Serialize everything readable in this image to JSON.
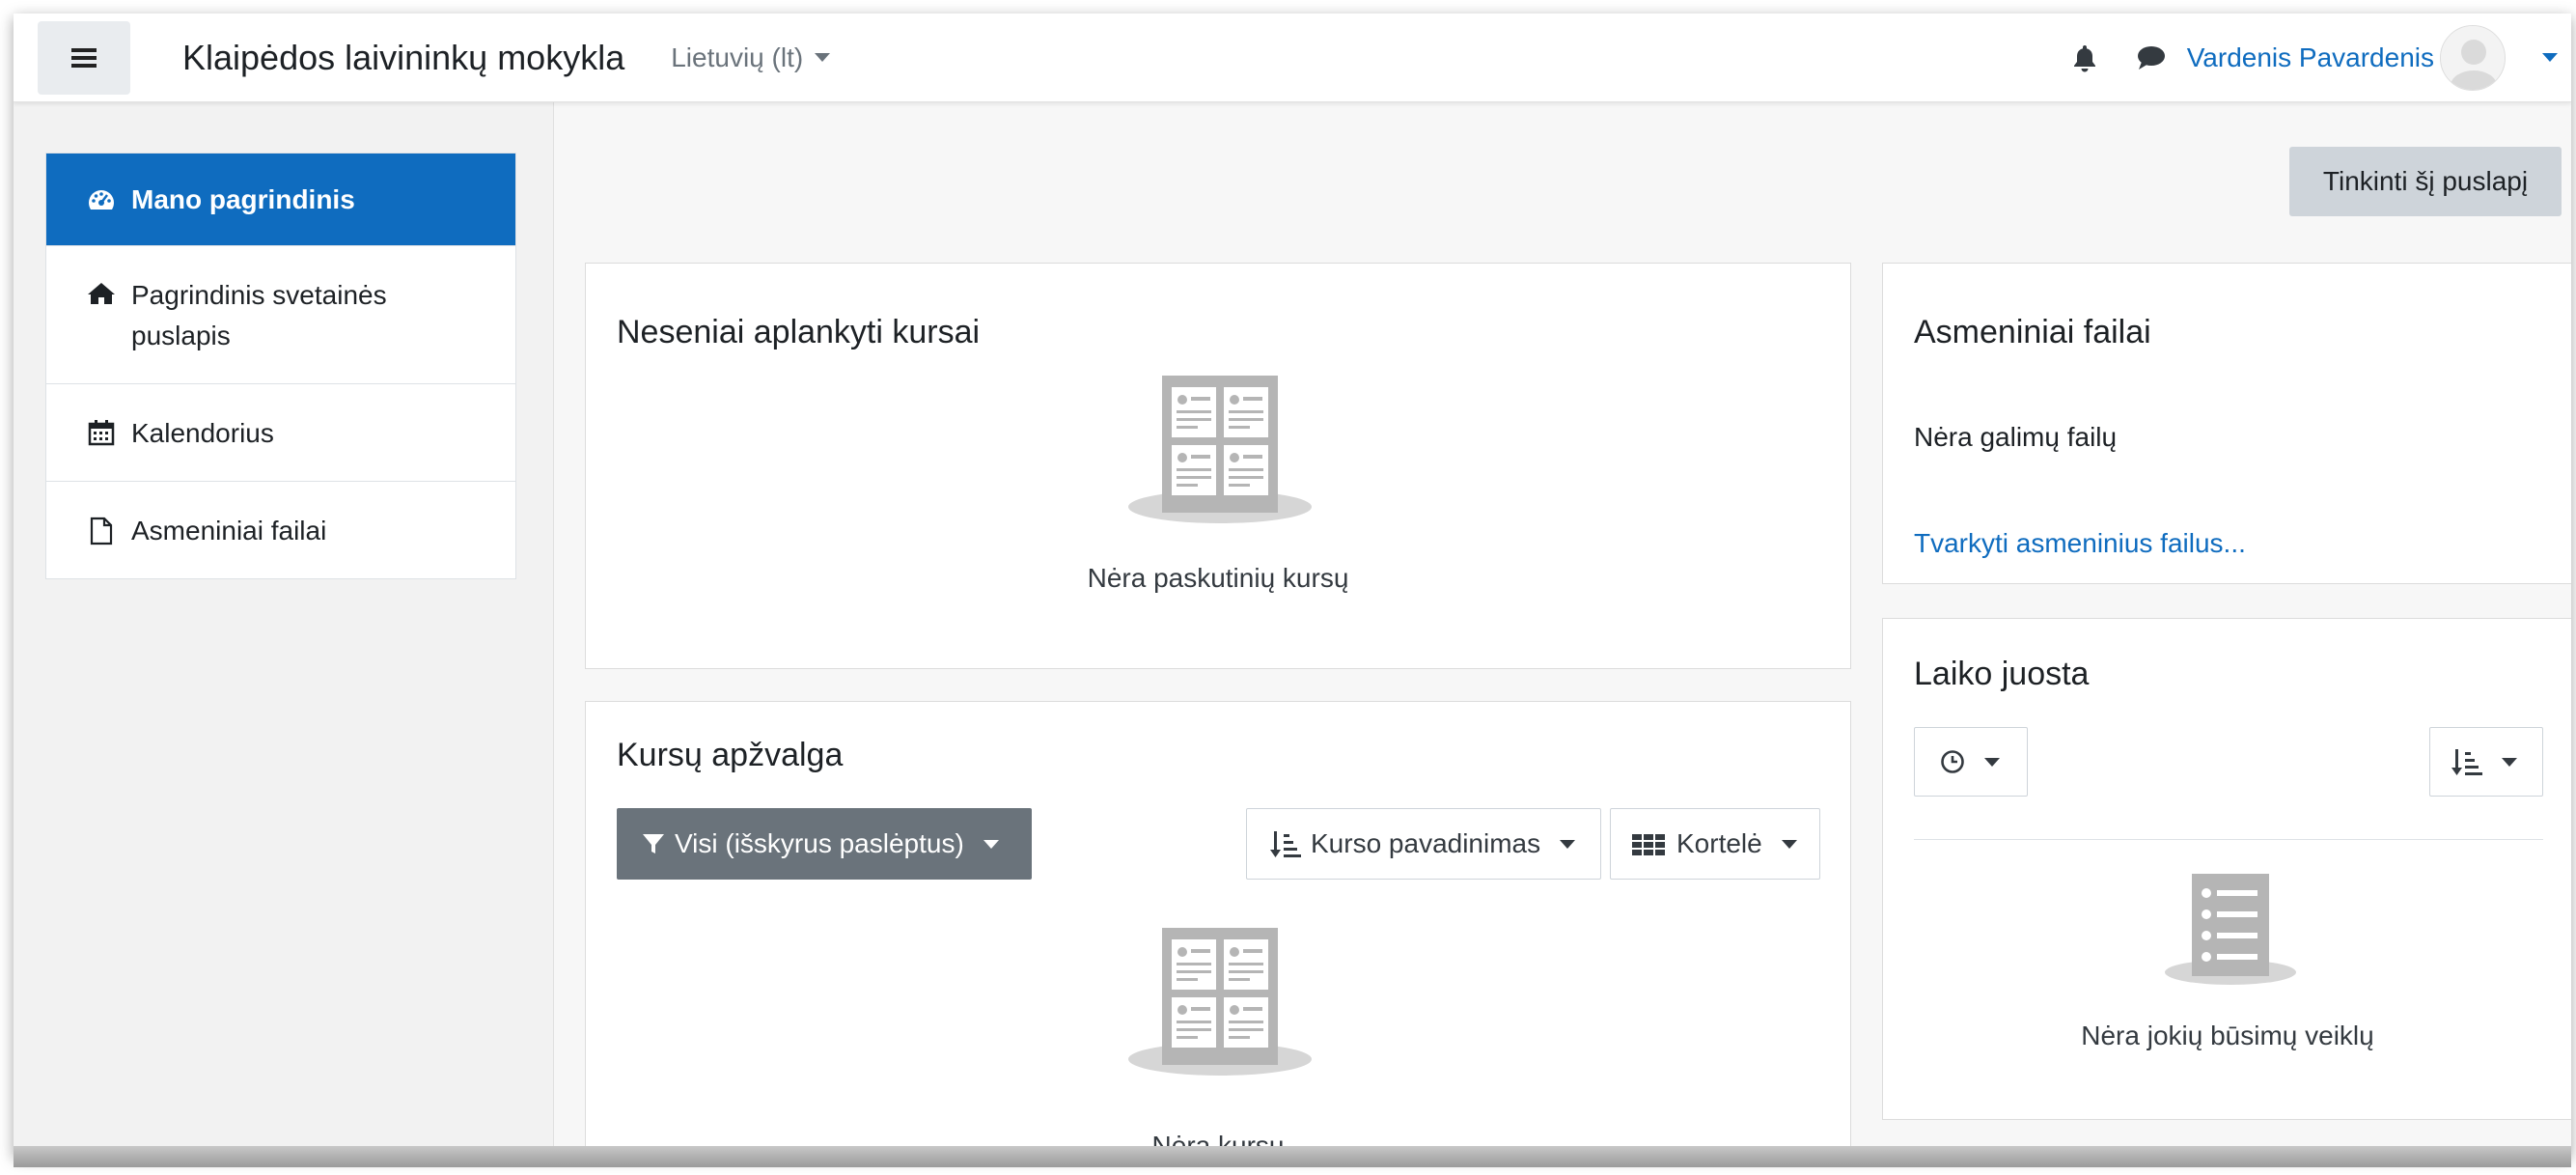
{
  "navbar": {
    "site_name": "Klaipėdos laivininkų mokykla",
    "language": "Lietuvių (lt)",
    "user_name": "Vardenis Pavardenis"
  },
  "drawer": {
    "items": [
      {
        "label": "Mano pagrindinis",
        "icon": "dashboard-icon",
        "active": true
      },
      {
        "label": "Pagrindinis svetainės puslapis",
        "icon": "home-icon",
        "active": false
      },
      {
        "label": "Kalendorius",
        "icon": "calendar-icon",
        "active": false
      },
      {
        "label": "Asmeniniai failai",
        "icon": "file-icon",
        "active": false
      }
    ]
  },
  "page": {
    "customize_label": "Tinkinti šį puslapį"
  },
  "recent_courses": {
    "title": "Neseniai aplankyti kursai",
    "empty_text": "Nėra paskutinių kursų"
  },
  "course_overview": {
    "title": "Kursų apžvalga",
    "filter_label": "Visi (išskyrus paslėptus)",
    "sort_label": "Kurso pavadinimas",
    "view_label": "Kortelė",
    "empty_text": "Nėra kursų"
  },
  "private_files": {
    "title": "Asmeniniai failai",
    "empty_text": "Nėra galimų failų",
    "manage_link": "Tvarkyti asmeninius failus..."
  },
  "timeline": {
    "title": "Laiko juosta",
    "empty_text": "Nėra jokių būsimų veiklų"
  },
  "colors": {
    "primary": "#0f6cbf",
    "secondary_btn": "#ced4da",
    "filter_btn": "#6a737b",
    "empty_illustration": "#b5b5b5"
  }
}
